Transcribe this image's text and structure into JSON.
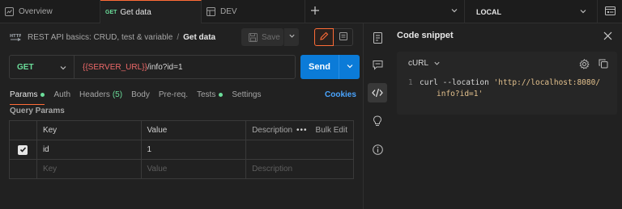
{
  "tabs": {
    "overview": "Overview",
    "active_method": "GET",
    "active_label": "Get data",
    "dev": "DEV"
  },
  "environment": {
    "selected": "LOCAL"
  },
  "breadcrumb": {
    "collection": "REST API basics: CRUD, test & variable",
    "separator": "/",
    "request": "Get data"
  },
  "toolbar": {
    "save_label": "Save"
  },
  "request": {
    "method": "GET",
    "url_variable": "{{SERVER_URL}}",
    "url_path": "/info?id=1",
    "send_label": "Send"
  },
  "request_tabs": {
    "params": "Params",
    "auth": "Auth",
    "headers": "Headers",
    "headers_count": "(5)",
    "body": "Body",
    "prereq": "Pre-req.",
    "tests": "Tests",
    "settings": "Settings",
    "cookies": "Cookies"
  },
  "query_params": {
    "title": "Query Params",
    "headers": {
      "key": "Key",
      "value": "Value",
      "description": "Description",
      "bulk_edit": "Bulk Edit",
      "more": "•••"
    },
    "rows": [
      {
        "key": "id",
        "value": "1",
        "description": "",
        "checked": true
      }
    ],
    "placeholder": {
      "key": "Key",
      "value": "Value",
      "description": "Description"
    }
  },
  "code_snippet": {
    "title": "Code snippet",
    "language": "cURL",
    "line1_number": "1",
    "line1_cmd": "curl --location ",
    "line1_str": "'http://localhost:8080/",
    "line2_str": "info?id=1'"
  },
  "icons": {
    "tab_overview": "overview-icon",
    "tab_dev": "environment-icon",
    "new_tab": "plus-icon",
    "right_toolbar": [
      "documentation-icon",
      "comments-icon",
      "code-icon",
      "lightbulb-icon",
      "info-icon"
    ]
  },
  "colors": {
    "accent": "#ff6c37",
    "get_method": "#6bdd9a",
    "send_button": "#0b7bd8",
    "url_variable": "#f06a6a",
    "link": "#4aa5ff"
  }
}
